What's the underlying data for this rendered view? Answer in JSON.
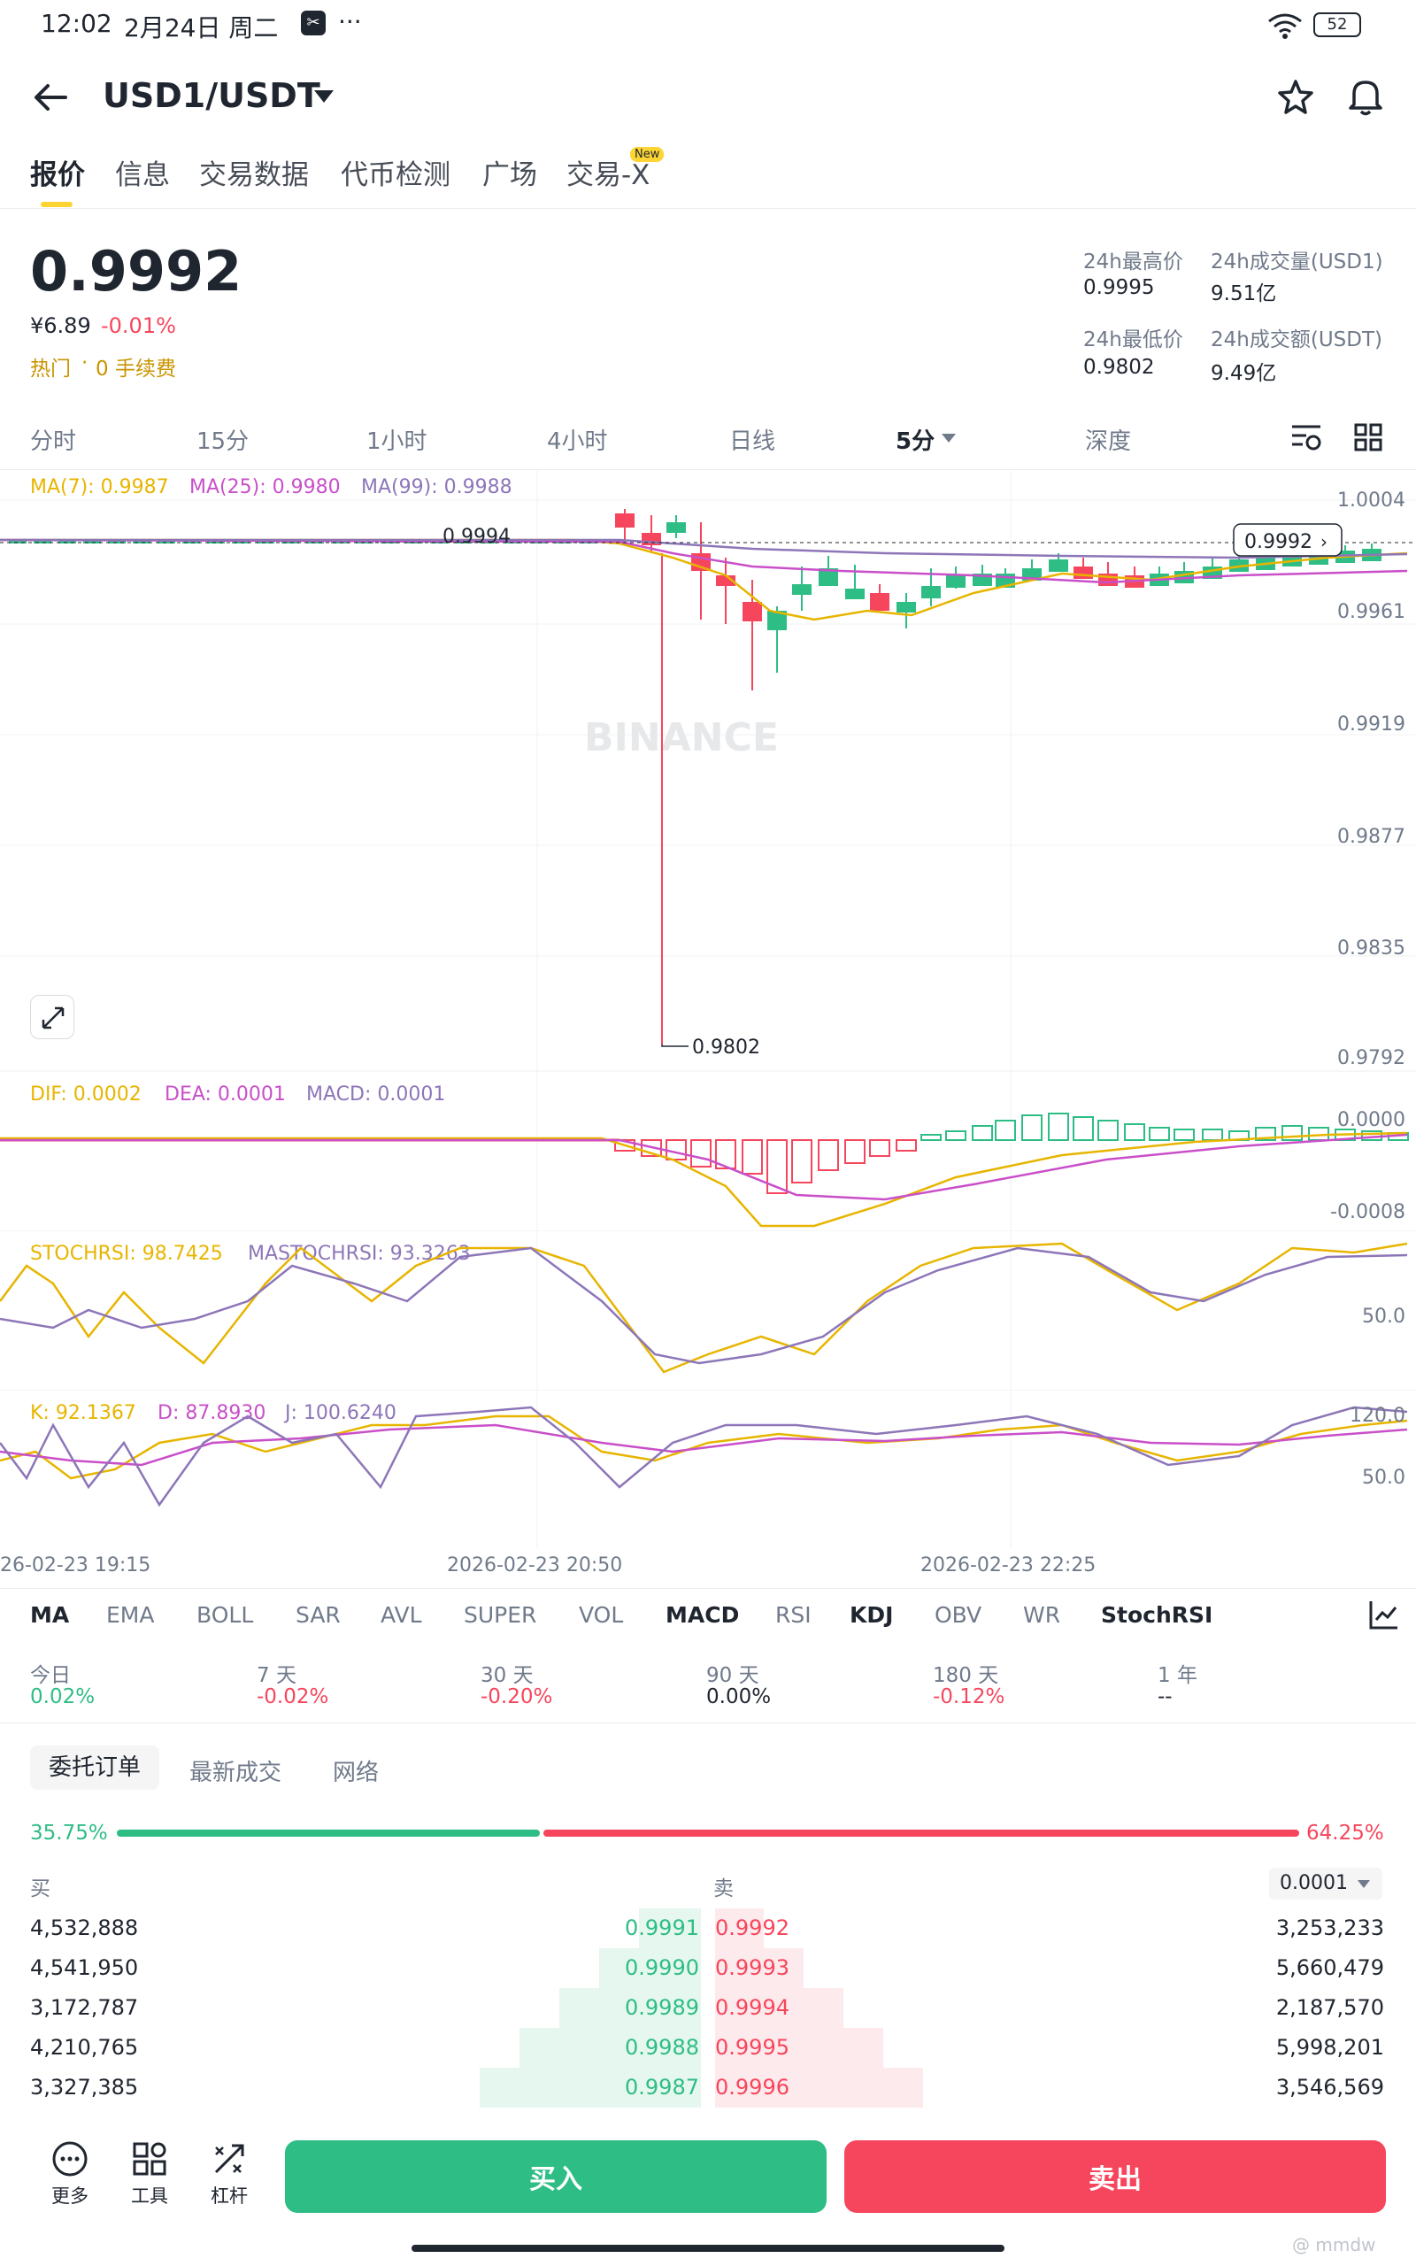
{
  "status_bar": {
    "time": "12:02",
    "date": "2月24日 周二",
    "dots": "···",
    "battery": "52"
  },
  "header": {
    "pair": "USD1/USDT"
  },
  "tabs": [
    "报价",
    "信息",
    "交易数据",
    "代币检测",
    "广场",
    "交易-X"
  ],
  "new_badge": "New",
  "price": {
    "last": "0.9992",
    "cny": "¥6.89",
    "change": "-0.01%",
    "tag_hot": "热门",
    "tag_fee": "0 手续费"
  },
  "stats": {
    "high_label": "24h最高价",
    "high": "0.9995",
    "vol_label": "24h成交量(USD1)",
    "vol": "9.51亿",
    "low_label": "24h最低价",
    "low": "0.9802",
    "amt_label": "24h成交额(USDT)",
    "amt": "9.49亿"
  },
  "timeframes": [
    "分时",
    "15分",
    "1小时",
    "4小时",
    "日线",
    "5分",
    "深度"
  ],
  "ma_legend": {
    "ma7": "MA(7): 0.9987",
    "ma25": "MA(25): 0.9980",
    "ma99": "MA(99): 0.9988"
  },
  "price_axis": [
    "1.0004",
    "0.9961",
    "0.9919",
    "0.9877",
    "0.9835",
    "0.9792"
  ],
  "current_price_tag": "0.9992",
  "high_marker": "0.9994",
  "low_marker": "0.9802",
  "watermark": "BINANCE",
  "macd_legend": {
    "dif": "DIF: 0.0002",
    "dea": "DEA: 0.0001",
    "macd": "MACD: 0.0001"
  },
  "macd_axis": [
    "0.0000",
    "-0.0008"
  ],
  "stoch_legend": {
    "k": "STOCHRSI: 98.7425",
    "d": "MASTOCHRSI: 93.3263"
  },
  "stoch_axis": [
    "50.0"
  ],
  "kdj_legend": {
    "k": "K: 92.1367",
    "d": "D: 87.8930",
    "j": "J: 100.6240"
  },
  "kdj_axis": [
    "120.0",
    "50.0"
  ],
  "time_axis": [
    "26-02-23 19:15",
    "2026-02-23 20:50",
    "2026-02-23 22:25"
  ],
  "indicator_tabs": [
    "MA",
    "EMA",
    "BOLL",
    "SAR",
    "AVL",
    "SUPER",
    "VOL",
    "MACD",
    "RSI",
    "KDJ",
    "OBV",
    "WR",
    "StochRSI"
  ],
  "performance": [
    {
      "label": "今日",
      "value": "0.02%",
      "dir": "up"
    },
    {
      "label": "7 天",
      "value": "-0.02%",
      "dir": "down"
    },
    {
      "label": "30 天",
      "value": "-0.20%",
      "dir": "down"
    },
    {
      "label": "90 天",
      "value": "0.00%",
      "dir": "flat"
    },
    {
      "label": "180 天",
      "value": "-0.12%",
      "dir": "down"
    },
    {
      "label": "1 年",
      "value": "--",
      "dir": "flat"
    }
  ],
  "order_tabs": [
    "委托订单",
    "最新成交",
    "网络"
  ],
  "ratio": {
    "buy": "35.75%",
    "sell": "64.25%",
    "buy_fraction": 0.3575
  },
  "book": {
    "buy_label": "买",
    "sell_label": "卖",
    "precision": "0.0001",
    "rows": [
      {
        "bid_qty": "4,532,888",
        "bid": "0.9991",
        "ask": "0.9992",
        "ask_qty": "3,253,233"
      },
      {
        "bid_qty": "4,541,950",
        "bid": "0.9990",
        "ask": "0.9993",
        "ask_qty": "5,660,479"
      },
      {
        "bid_qty": "3,172,787",
        "bid": "0.9989",
        "ask": "0.9994",
        "ask_qty": "2,187,570"
      },
      {
        "bid_qty": "4,210,765",
        "bid": "0.9988",
        "ask": "0.9995",
        "ask_qty": "5,998,201"
      },
      {
        "bid_qty": "3,327,385",
        "bid": "0.9987",
        "ask": "0.9996",
        "ask_qty": "3,546,569"
      }
    ]
  },
  "bottom": {
    "more": "更多",
    "tools": "工具",
    "leverage": "杠杆",
    "buy": "买入",
    "sell": "卖出"
  },
  "watermark_user": "@ mmdw"
}
